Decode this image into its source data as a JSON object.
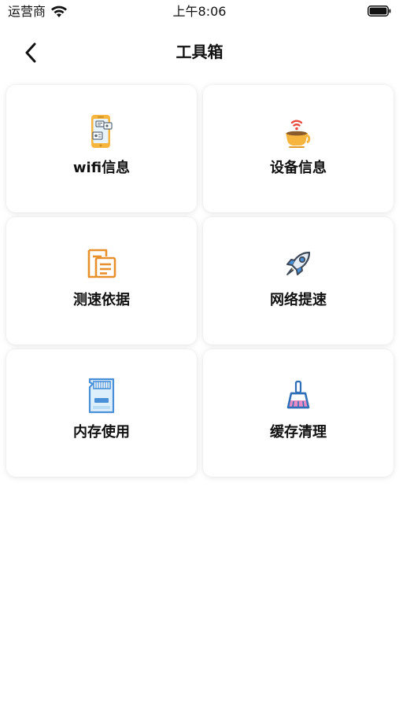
{
  "status_bar": {
    "carrier": "运营商",
    "time": "上午8:06"
  },
  "header": {
    "title": "工具箱"
  },
  "tools": [
    {
      "label": "wifi信息",
      "icon": "phone-id-icon"
    },
    {
      "label": "设备信息",
      "icon": "coffee-cup-icon"
    },
    {
      "label": "测速依据",
      "icon": "document-icon"
    },
    {
      "label": "网络提速",
      "icon": "rocket-icon"
    },
    {
      "label": "内存使用",
      "icon": "sd-card-icon"
    },
    {
      "label": "缓存清理",
      "icon": "broom-icon"
    }
  ],
  "colors": {
    "accent_orange": "#E8902C",
    "accent_blue": "#4A90D9",
    "card_background": "#FFFFFF"
  }
}
